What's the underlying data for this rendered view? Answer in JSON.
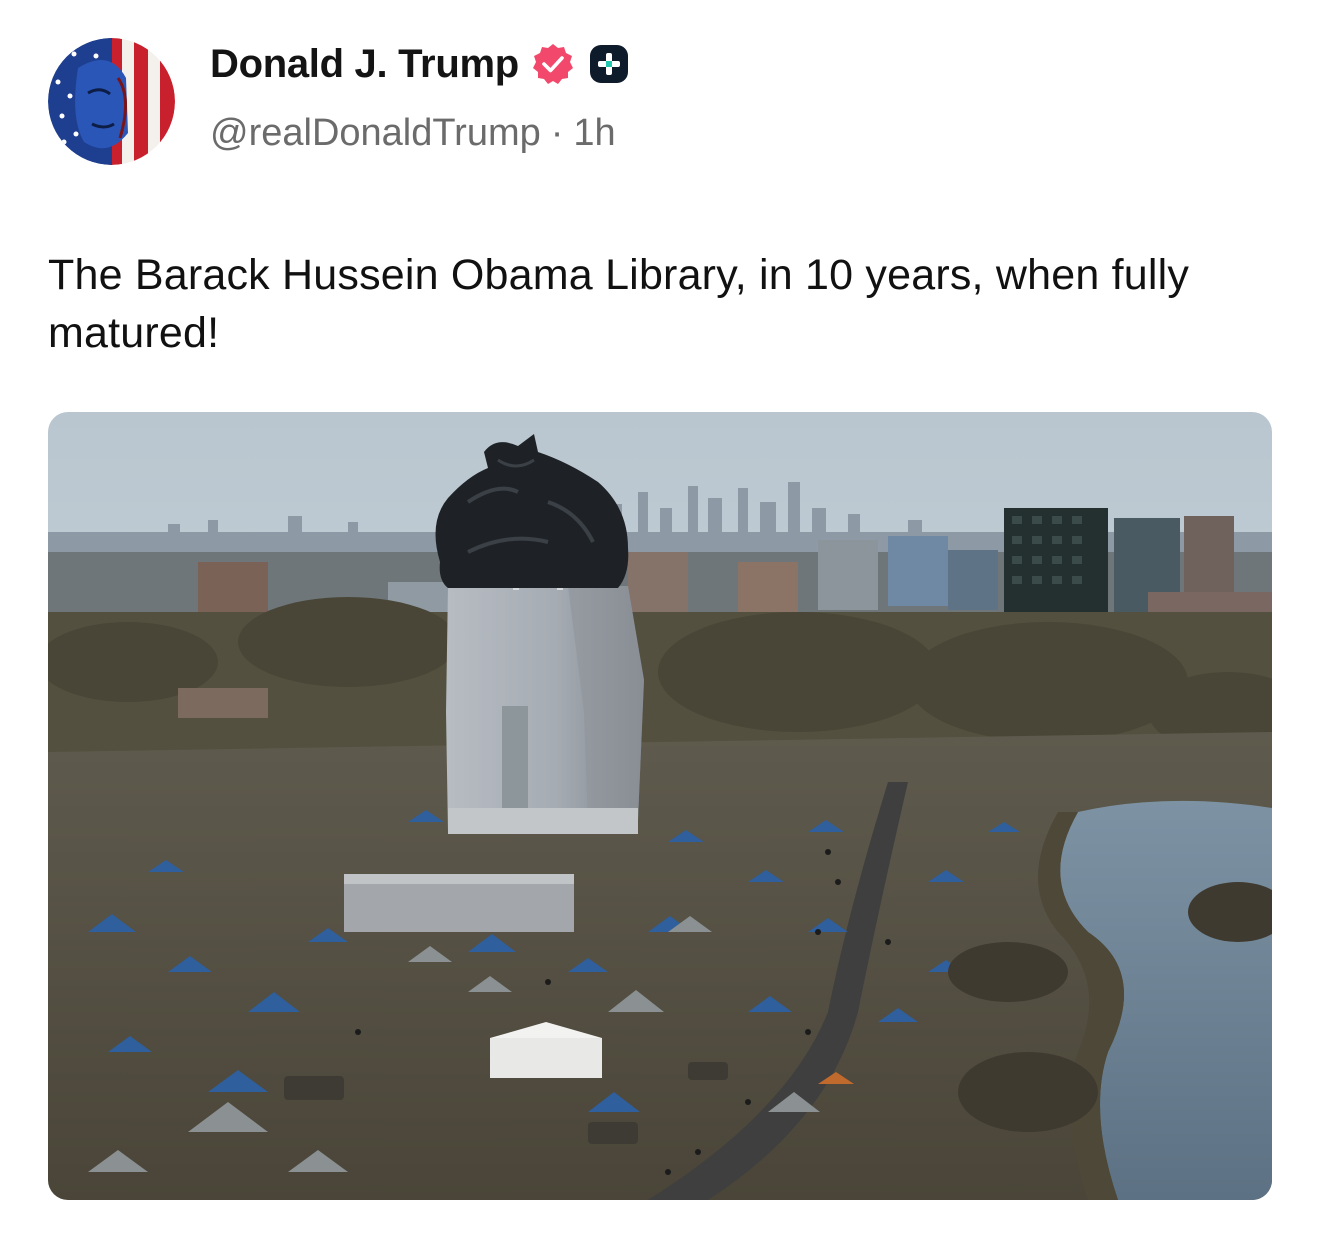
{
  "post": {
    "author": {
      "display_name": "Donald J. Trump",
      "handle": "@realDonaldTrump",
      "separator": "·",
      "time": "1h",
      "verified_icon": "verified-badge-icon",
      "badge_icon": "plus-badge-icon",
      "verified_color": "#f2486b"
    },
    "text": "The Barack Hussein Obama Library, in 10 years, when fully matured!",
    "media": {
      "alt": "Garbage-bag topped tower surrounded by tent encampment beside a river with a city skyline behind"
    }
  }
}
